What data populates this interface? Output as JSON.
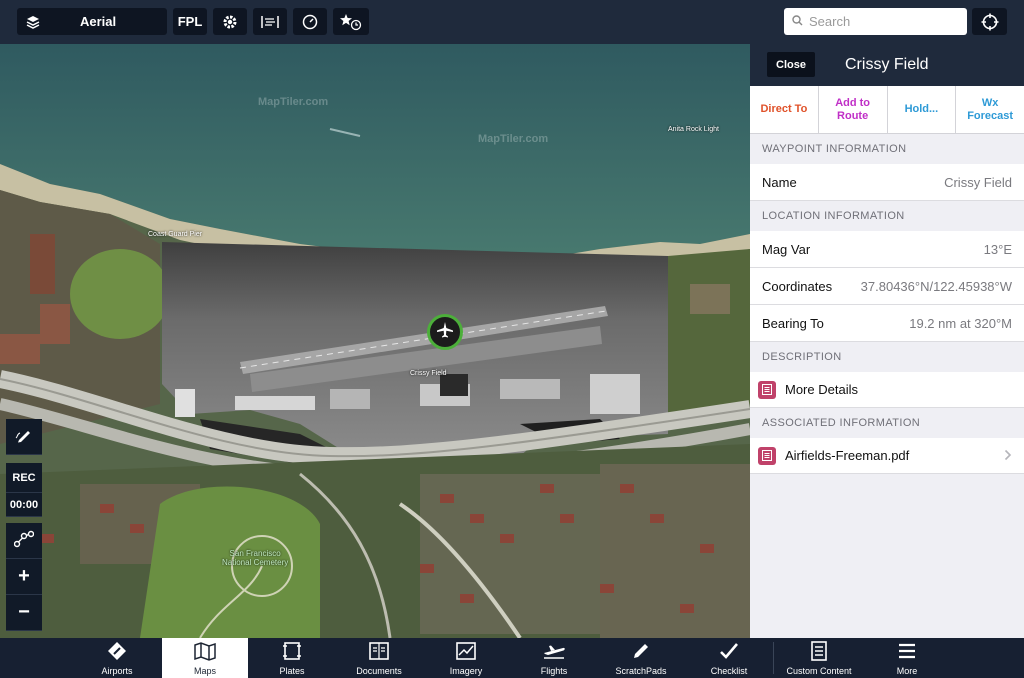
{
  "toolbar": {
    "layer_label": "Aerial",
    "fpl_label": "FPL",
    "search_placeholder": "Search",
    "icons": [
      "layers-icon",
      "gear-icon",
      "wind-icon",
      "timer-icon",
      "star-clock-icon",
      "crosshair-icon"
    ]
  },
  "map": {
    "labels": {
      "watermark1": "MapTiler.com",
      "watermark2": "MapTiler.com",
      "anita_rock": "Anita Rock Light",
      "coast_guard": "Coast Guard Pier",
      "crissy": "Crissy Field",
      "cemetery_line1": "San Francisco",
      "cemetery_line2": "National Cemetery"
    },
    "side_tools": {
      "rec_label": "REC",
      "timer_label": "00:00",
      "zoom_in": "+",
      "zoom_out": "−"
    }
  },
  "panel": {
    "close_label": "Close",
    "title": "Crissy Field",
    "actions": [
      {
        "label": "Direct To",
        "color": "#e0522a"
      },
      {
        "label": "Add to Route",
        "color": "#c02fc7"
      },
      {
        "label": "Hold...",
        "color": "#2e9ad6"
      },
      {
        "label": "Wx Forecast",
        "color": "#2e9ad6"
      }
    ],
    "sections": {
      "waypoint": "WAYPOINT INFORMATION",
      "location": "LOCATION INFORMATION",
      "description": "DESCRIPTION",
      "associated": "ASSOCIATED INFORMATION"
    },
    "name": {
      "label": "Name",
      "value": "Crissy Field"
    },
    "mag_var": {
      "label": "Mag Var",
      "value": "13°E"
    },
    "coordinates": {
      "label": "Coordinates",
      "value": "37.80436°N/122.45938°W"
    },
    "bearing": {
      "label": "Bearing To",
      "value": "19.2 nm at 320°M"
    },
    "more_details": "More Details",
    "document": "Airfields-Freeman.pdf"
  },
  "tabs": [
    {
      "label": "Airports",
      "icon": "airport-diamond-icon"
    },
    {
      "label": "Maps",
      "icon": "map-icon",
      "active": true
    },
    {
      "label": "Plates",
      "icon": "plates-icon"
    },
    {
      "label": "Documents",
      "icon": "documents-icon"
    },
    {
      "label": "Imagery",
      "icon": "imagery-icon"
    },
    {
      "label": "Flights",
      "icon": "airplane-icon"
    },
    {
      "label": "ScratchPads",
      "icon": "pencil-icon"
    },
    {
      "label": "Checklist",
      "icon": "checkmark-icon"
    },
    {
      "label": "Custom Content",
      "icon": "custom-content-icon"
    },
    {
      "label": "More",
      "icon": "menu-icon"
    }
  ]
}
